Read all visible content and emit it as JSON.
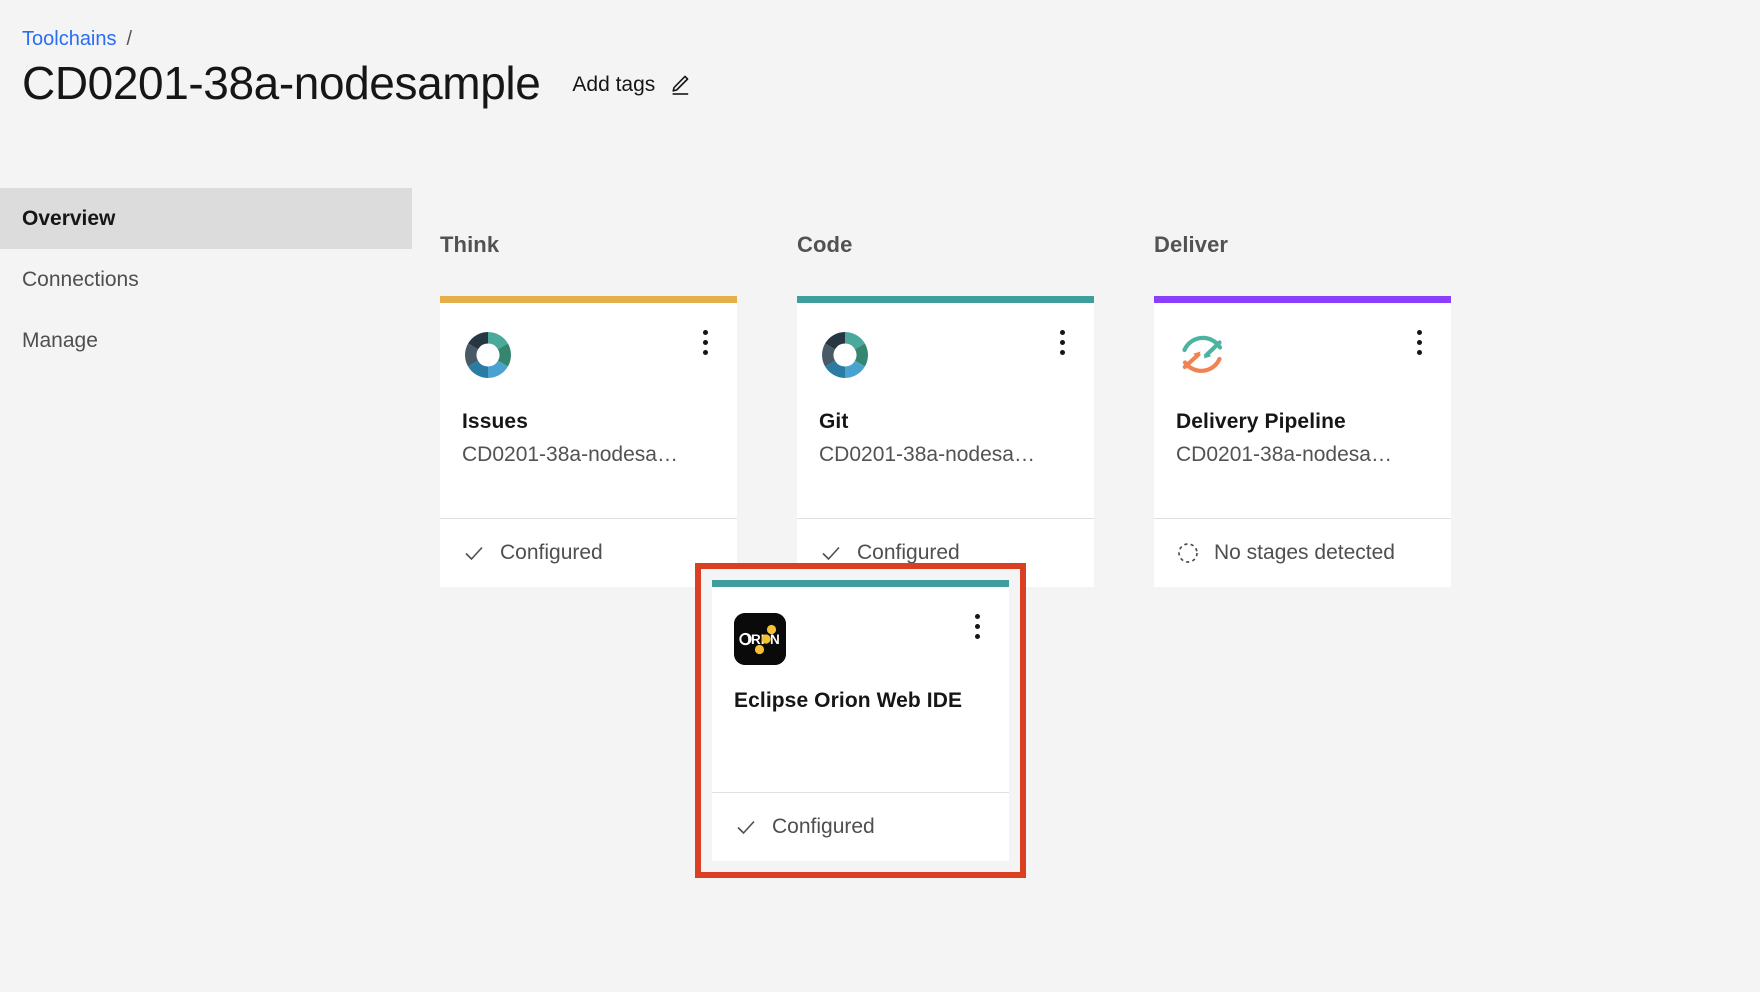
{
  "breadcrumb": {
    "link_label": "Toolchains",
    "separator": "/"
  },
  "header": {
    "title": "CD0201-38a-nodesample",
    "add_tags_label": "Add tags",
    "edit_icon": "pencil-icon"
  },
  "sidebar": {
    "items": [
      {
        "label": "Overview",
        "active": true
      },
      {
        "label": "Connections",
        "active": false
      },
      {
        "label": "Manage",
        "active": false
      }
    ]
  },
  "colors": {
    "think_accent": "#e3b04b",
    "code_accent": "#3f9e9c",
    "deliver_accent": "#8a3ffc",
    "highlight_border": "#d93f21",
    "link": "#2b6cf5",
    "sidebar_active_bg": "#dcdcdc",
    "page_bg": "#f4f4f4",
    "card_bg": "#ffffff"
  },
  "board": {
    "columns": [
      {
        "header": "Think",
        "card": {
          "accent": "#e3b04b",
          "icon": "donut-icon",
          "name": "Issues",
          "subtitle": "CD0201-38a-nodesa…",
          "status_label": "Configured",
          "status_icon": "check-icon",
          "overflow_icon": "overflow-menu-icon"
        }
      },
      {
        "header": "Code",
        "card": {
          "accent": "#3f9e9c",
          "icon": "donut-icon",
          "name": "Git",
          "subtitle": "CD0201-38a-nodesa…",
          "status_label": "Configured",
          "status_icon": "check-icon",
          "overflow_icon": "overflow-menu-icon"
        }
      },
      {
        "header": "Deliver",
        "card": {
          "accent": "#8a3ffc",
          "icon": "pipeline-loop-icon",
          "name": "Delivery Pipeline",
          "subtitle": "CD0201-38a-nodesa…",
          "status_label": "No stages detected",
          "status_icon": "dashed-circle-icon",
          "overflow_icon": "overflow-menu-icon"
        }
      }
    ]
  },
  "highlighted_card": {
    "accent": "#3f9e9c",
    "icon": "orion-logo-icon",
    "icon_text": "ORION",
    "name": "Eclipse Orion Web IDE",
    "subtitle": "",
    "status_label": "Configured",
    "status_icon": "check-icon",
    "overflow_icon": "overflow-menu-icon"
  }
}
